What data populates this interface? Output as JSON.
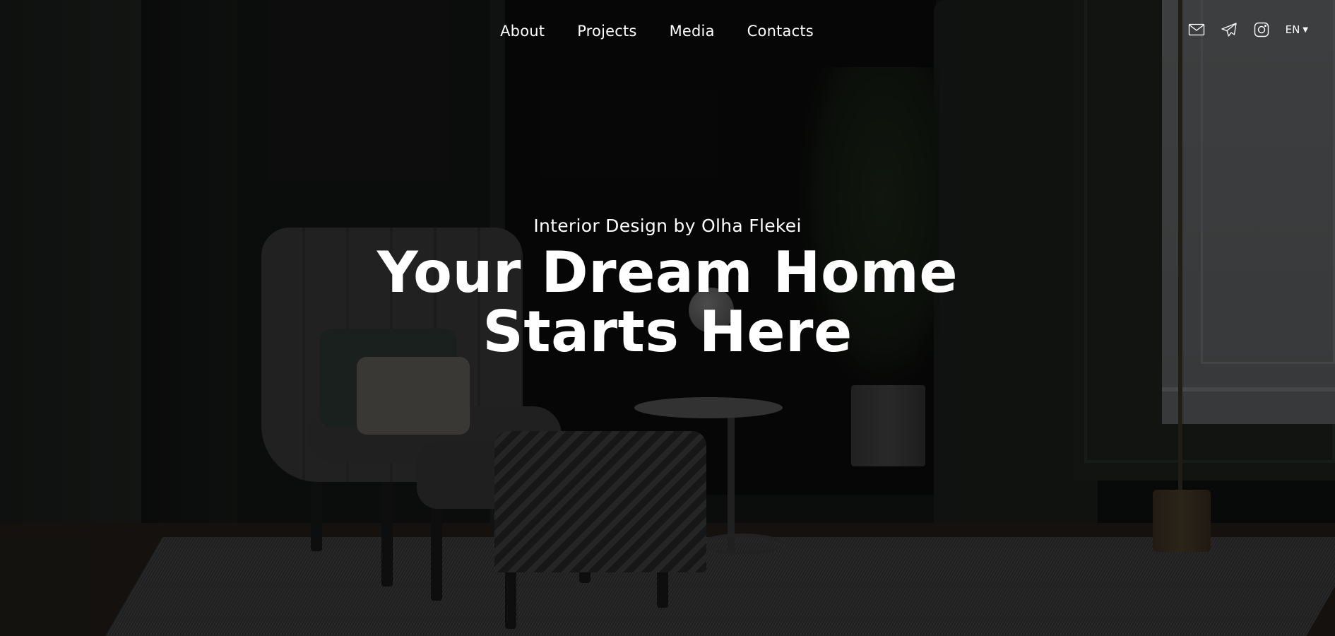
{
  "nav": {
    "links": [
      "About",
      "Projects",
      "Media",
      "Contacts"
    ]
  },
  "tools": {
    "icons": [
      "mail-icon",
      "telegram-icon",
      "instagram-icon"
    ],
    "language": "EN"
  },
  "hero": {
    "subtitle": "Interior Design by Olha Flekei",
    "title_line1": "Your Dream Home",
    "title_line2": "Starts Here"
  }
}
